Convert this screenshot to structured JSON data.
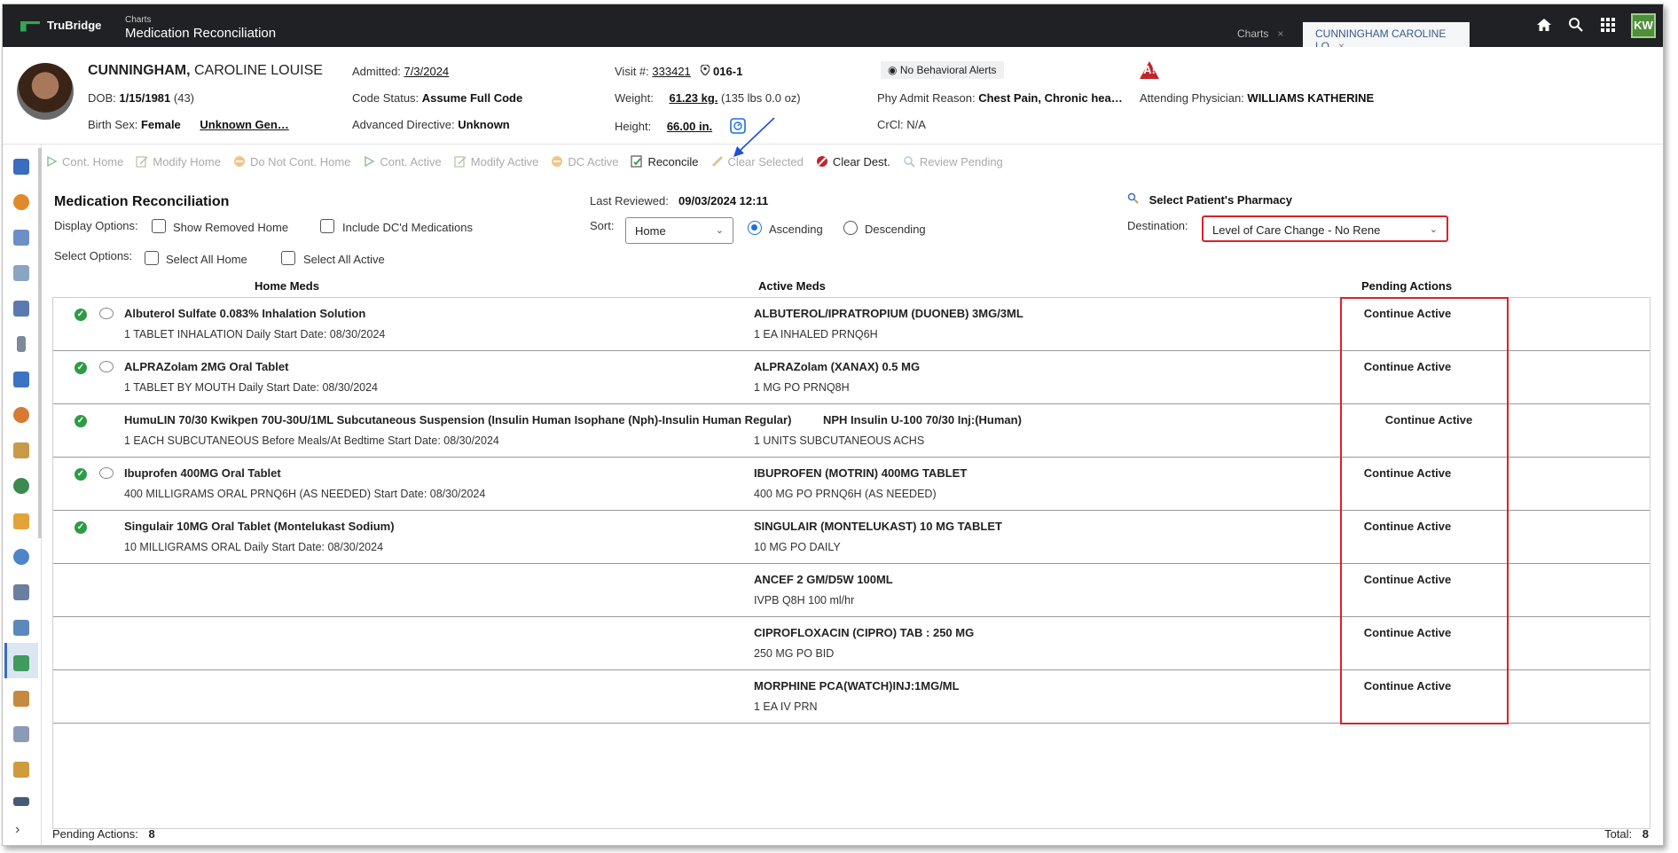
{
  "app": {
    "brand": "TruBridge",
    "breadcrumb": "Charts",
    "title": "Medication Reconciliation",
    "tabs": [
      {
        "label": "Charts",
        "close": "×"
      },
      {
        "label": "CUNNINGHAM CAROLINE LO",
        "close": "×"
      }
    ],
    "user_initials": "KW"
  },
  "patient": {
    "last_name": "CUNNINGHAM,",
    "first_name": "CAROLINE LOUISE",
    "dob_label": "DOB:",
    "dob": "1/15/1981",
    "age": "(43)",
    "birth_sex_label": "Birth Sex:",
    "birth_sex": "Female",
    "gender": "Unknown Gen…",
    "admitted_label": "Admitted:",
    "admitted": "7/3/2024",
    "code_status_label": "Code Status:",
    "code_status": "Assume Full Code",
    "adv_directive_label": "Advanced Directive:",
    "adv_directive": "Unknown",
    "visit_label": "Visit #:",
    "visit": "333421",
    "location": "016-1",
    "weight_label": "Weight:",
    "weight": "61.23 kg.",
    "weight_alt": "(135 lbs 0.0 oz)",
    "height_label": "Height:",
    "height": "66.00 in.",
    "behavioral_alerts": "No Behavioral Alerts",
    "admit_reason_label": "Phy Admit Reason:",
    "admit_reason": "Chest Pain, Chronic hea…",
    "crcl_label": "CrCl:",
    "crcl": "N/A",
    "attending_label": "Attending Physician:",
    "attending": "WILLIAMS KATHERINE",
    "alert_badge": "A!"
  },
  "toolbar": [
    {
      "label": "Cont. Home",
      "enabled": false
    },
    {
      "label": "Modify Home",
      "enabled": false
    },
    {
      "label": "Do Not Cont. Home",
      "enabled": false
    },
    {
      "label": "Cont. Active",
      "enabled": false
    },
    {
      "label": "Modify Active",
      "enabled": false
    },
    {
      "label": "DC Active",
      "enabled": false
    },
    {
      "label": "Reconcile",
      "enabled": true
    },
    {
      "label": "Clear Selected",
      "enabled": false
    },
    {
      "label": "Clear Dest.",
      "enabled": true
    },
    {
      "label": "Review Pending",
      "enabled": false
    }
  ],
  "panel": {
    "title": "Medication Reconciliation",
    "display_options_label": "Display Options:",
    "show_removed_home": "Show Removed Home",
    "include_dc": "Include DC'd Medications",
    "select_options_label": "Select Options:",
    "select_all_home": "Select All Home",
    "select_all_active": "Select All Active",
    "last_reviewed_label": "Last Reviewed:",
    "last_reviewed": "09/03/2024 12:11",
    "sort_label": "Sort:",
    "sort_value": "Home",
    "ascending": "Ascending",
    "descending": "Descending",
    "pharmacy_link": "Select Patient's Pharmacy",
    "destination_label": "Destination:",
    "destination_value": "Level of Care Change - No Rene",
    "col_home": "Home Meds",
    "col_active": "Active Meds",
    "col_pending": "Pending Actions"
  },
  "rows": [
    {
      "home_name": "Albuterol Sulfate 0.083% Inhalation Solution",
      "home_sig": "1 TABLET INHALATION Daily Start Date: 08/30/2024",
      "active_name": "ALBUTEROL/IPRATROPIUM (DUONEB) 3MG/3ML",
      "active_sig": "1 EA INHALED PRNQ6H",
      "action": "Continue Active"
    },
    {
      "home_name": "ALPRAZolam 2MG Oral Tablet",
      "home_sig": "1 TABLET BY MOUTH Daily Start Date: 08/30/2024",
      "active_name": "ALPRAZolam (XANAX) 0.5 MG",
      "active_sig": "1 MG PO PRNQ8H",
      "action": "Continue Active"
    },
    {
      "home_name": "HumuLIN 70/30 Kwikpen 70U-30U/1ML Subcutaneous Suspension (Insulin Human Isophane (Nph)-Insulin Human Regular)",
      "home_sig": "1 EACH SUBCUTANEOUS Before Meals/At Bedtime Start Date: 08/30/2024",
      "active_name": "NPH Insulin U-100 70/30 Inj:(Human)",
      "active_sig": "1 UNITS SUBCUTANEOUS ACHS",
      "action": "Continue Active"
    },
    {
      "home_name": "Ibuprofen 400MG Oral Tablet",
      "home_sig": "400 MILLIGRAMS ORAL PRNQ6H (AS NEEDED) Start Date: 08/30/2024",
      "active_name": "IBUPROFEN (MOTRIN) 400MG TABLET",
      "active_sig": "400 MG PO PRNQ6H (AS NEEDED)",
      "action": "Continue Active"
    },
    {
      "home_name": "Singulair 10MG Oral Tablet (Montelukast Sodium)",
      "home_sig": "10 MILLIGRAMS ORAL Daily Start Date: 08/30/2024",
      "active_name": "SINGULAIR (MONTELUKAST) 10 MG TABLET",
      "active_sig": "10 MG PO DAILY",
      "action": "Continue Active"
    },
    {
      "home_name": "",
      "home_sig": "",
      "active_name": "ANCEF 2 GM/D5W 100ML",
      "active_sig": "IVPB Q8H 100 ml/hr",
      "action": "Continue Active"
    },
    {
      "home_name": "",
      "home_sig": "",
      "active_name": "CIPROFLOXACIN (CIPRO) TAB : 250 MG",
      "active_sig": "250 MG PO BID",
      "action": "Continue Active"
    },
    {
      "home_name": "",
      "home_sig": "",
      "active_name": "MORPHINE PCA(WATCH)INJ:1MG/ML",
      "active_sig": "1 EA IV PRN",
      "action": "Continue Active"
    }
  ],
  "footer": {
    "pending_label": "Pending Actions:",
    "pending_count": "8",
    "total_label": "Total:",
    "total_count": "8"
  },
  "colors": {
    "topbar": "#1f2124",
    "highlight_red": "#d8232a",
    "radio_blue": "#1e6fd9",
    "check_green": "#2e9b47"
  }
}
